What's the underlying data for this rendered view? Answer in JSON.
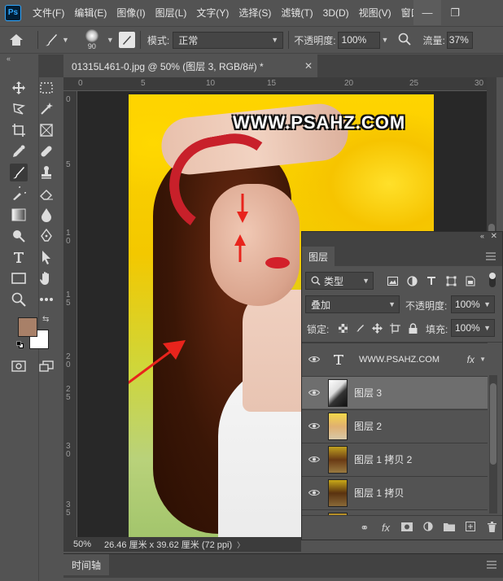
{
  "app": {
    "logo": "Ps"
  },
  "menu": [
    "文件(F)",
    "编辑(E)",
    "图像(I)",
    "图层(L)",
    "文字(Y)",
    "选择(S)",
    "滤镜(T)",
    "3D(D)",
    "视图(V)",
    "窗口"
  ],
  "window_controls": {
    "minimize": "—",
    "restore": "❐"
  },
  "options": {
    "brush_size": "90",
    "mode_label": "模式:",
    "mode_value": "正常",
    "opacity_label": "不透明度:",
    "opacity_value": "100%",
    "flow_label": "流量:",
    "flow_value": "37%"
  },
  "document": {
    "tab_title": "01315L461-0.jpg @ 50% (图层 3, RGB/8#) *",
    "close": "✕"
  },
  "ruler": {
    "h_ticks": [
      "0",
      "5",
      "10",
      "15",
      "20",
      "25",
      "30"
    ],
    "v_ticks": [
      "0",
      "5",
      "1\n0",
      "1\n5",
      "2\n0",
      "2\n5",
      "3\n0",
      "3\n5"
    ]
  },
  "canvas": {
    "watermark": "WWW.PSAHZ.COM"
  },
  "status": {
    "zoom": "50%",
    "info": "26.46 厘米 x 39.62 厘米 (72 ppi)",
    "more": "〉"
  },
  "timeline": {
    "label": "时间轴"
  },
  "colors": {
    "foreground": "#a88068",
    "background": "#ffffff"
  },
  "layers_panel": {
    "title": "图层",
    "filter_value": "类型",
    "blend_mode": "叠加",
    "opacity_label": "不透明度:",
    "opacity_value": "100%",
    "lock_label": "锁定:",
    "fill_label": "填充:",
    "fill_value": "100%",
    "layers": [
      {
        "name": "WWW.PSAHZ.COM",
        "type": "text",
        "fx": "fx"
      },
      {
        "name": "图层 3",
        "selected": true
      },
      {
        "name": "图层 2"
      },
      {
        "name": "图层 1 拷贝 2"
      },
      {
        "name": "图层 1 拷贝"
      }
    ]
  }
}
